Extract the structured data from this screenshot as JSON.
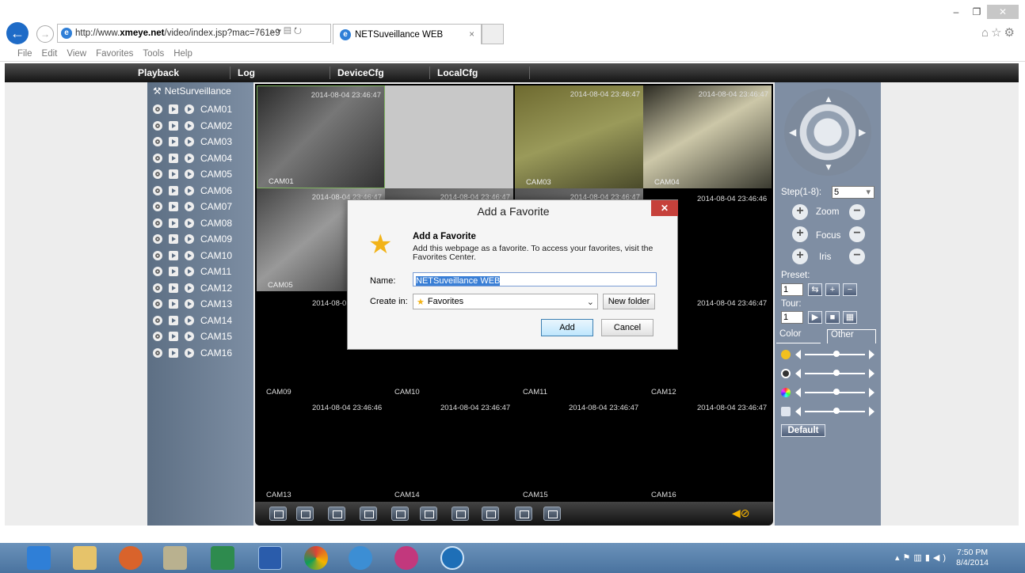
{
  "browser": {
    "url_prefix": "http://www.",
    "url_host": "xmeye.net",
    "url_path": "/video/index.jsp?mac=761e9",
    "tab_title": "NETSuveillance WEB",
    "menu": [
      "File",
      "Edit",
      "View",
      "Favorites",
      "Tools",
      "Help"
    ]
  },
  "app_nav": {
    "playback": "Playback",
    "log": "Log",
    "devicecfg": "DeviceCfg",
    "localcfg": "LocalCfg"
  },
  "tree": {
    "root": "NetSurveillance",
    "cameras": [
      "CAM01",
      "CAM02",
      "CAM03",
      "CAM04",
      "CAM05",
      "CAM06",
      "CAM07",
      "CAM08",
      "CAM09",
      "CAM10",
      "CAM11",
      "CAM12",
      "CAM13",
      "CAM14",
      "CAM15",
      "CAM16"
    ]
  },
  "grid": {
    "timestamp": "2014-08-04 23:46:47",
    "timestamp_alt": "2014-08-04 23:46:46",
    "timestamp_cut": "2014-08-0",
    "labels": {
      "cam01": "CAM01",
      "cam03": "CAM03",
      "cam04": "CAM04",
      "cam05": "CAM05",
      "cam09": "CAM09",
      "cam10": "CAM10",
      "cam11": "CAM11",
      "cam12": "CAM12",
      "cam13": "CAM13",
      "cam14": "CAM14",
      "cam15": "CAM15",
      "cam16": "CAM16"
    }
  },
  "ptz": {
    "step_label": "Step(1-8):",
    "step_value": "5",
    "zoom": "Zoom",
    "focus": "Focus",
    "iris": "Iris",
    "preset_label": "Preset:",
    "preset_value": "1",
    "tour_label": "Tour:",
    "tour_value": "1",
    "color_tab": "Color",
    "other_tab": "Other",
    "sliders": [
      0.5,
      0.5,
      0.5,
      0.5
    ],
    "default_button": "Default"
  },
  "dialog": {
    "title": "Add a Favorite",
    "heading": "Add a Favorite",
    "description": "Add this webpage as a favorite. To access your favorites, visit the Favorites Center.",
    "name_label": "Name:",
    "name_value": "NETSuveillance WEB",
    "create_label": "Create in:",
    "create_value": "Favorites",
    "new_folder": "New folder",
    "add": "Add",
    "cancel": "Cancel"
  },
  "taskbar": {
    "time": "7:50 PM",
    "date": "8/4/2014"
  }
}
